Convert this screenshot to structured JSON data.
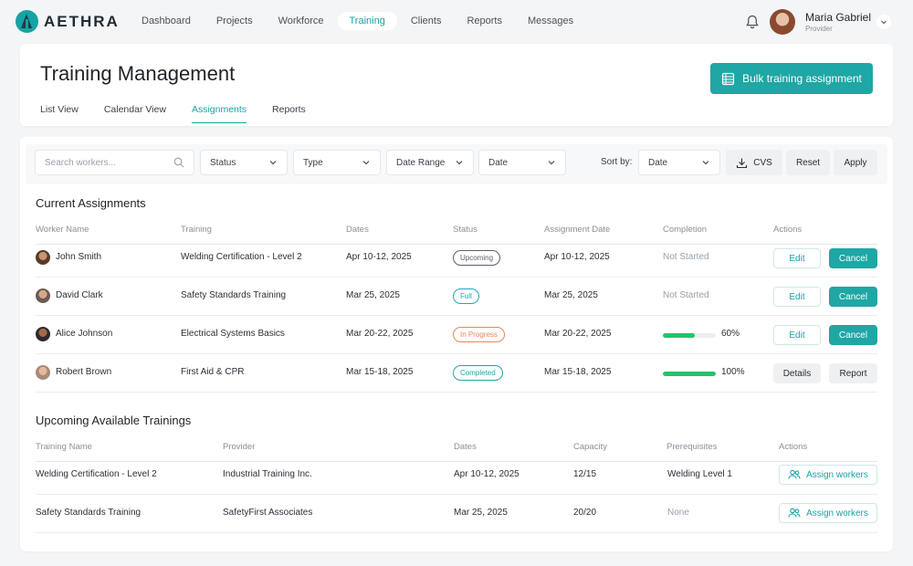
{
  "brand": {
    "name": "AETHRA"
  },
  "nav": {
    "items": [
      {
        "label": "Dashboard"
      },
      {
        "label": "Projects"
      },
      {
        "label": "Workforce"
      },
      {
        "label": "Training"
      },
      {
        "label": "Clients"
      },
      {
        "label": "Reports"
      },
      {
        "label": "Messages"
      }
    ],
    "active": "Training"
  },
  "user": {
    "name": "Maria Gabriel",
    "role": "Provider"
  },
  "page": {
    "title": "Training Management",
    "bulk_button": "Bulk training assignment",
    "tabs": [
      {
        "label": "List View"
      },
      {
        "label": "Calendar View"
      },
      {
        "label": "Assignments"
      },
      {
        "label": "Reports"
      }
    ],
    "active_tab": "Assignments"
  },
  "filters": {
    "search_placeholder": "Search workers...",
    "status": "Status",
    "type": "Type",
    "date_range": "Date Range",
    "date": "Date",
    "sort_label": "Sort by:",
    "sort_value": "Date",
    "export": "CVS",
    "reset": "Reset",
    "apply": "Apply"
  },
  "assignments": {
    "title": "Current Assignments",
    "columns": [
      "Worker Name",
      "Training",
      "Dates",
      "Status",
      "Assignment Date",
      "Completion",
      "Actions"
    ],
    "rows": [
      {
        "name": "John Smith",
        "training": "Welding Certification - Level 2",
        "dates": "Apr 10-12, 2025",
        "status": "Upcoming",
        "assigned": "Apr 10-12, 2025",
        "completion_text": "Not Started",
        "action1": "Edit",
        "action2": "Cancel"
      },
      {
        "name": "David Clark",
        "training": "Safety Standards Training",
        "dates": "Mar 25, 2025",
        "status": "Full",
        "assigned": "Mar 25, 2025",
        "completion_text": "Not Started",
        "action1": "Edit",
        "action2": "Cancel"
      },
      {
        "name": "Alice Johnson",
        "training": "Electrical Systems Basics",
        "dates": "Mar 20-22, 2025",
        "status": "In Progress",
        "assigned": "Mar 20-22, 2025",
        "completion_text": "60%",
        "completion": 0.6,
        "action1": "Edit",
        "action2": "Cancel"
      },
      {
        "name": "Robert Brown",
        "training": "First Aid & CPR",
        "dates": "Mar 15-18, 2025",
        "status": "Completed",
        "assigned": "Mar 15-18, 2025",
        "completion_text": "100%",
        "completion": 1.0,
        "action1": "Details",
        "action2": "Report"
      }
    ]
  },
  "upcoming": {
    "title": "Upcoming Available Trainings",
    "columns": [
      "Training Name",
      "Provider",
      "Dates",
      "Capacity",
      "Prerequisites",
      "Actions"
    ],
    "rows": [
      {
        "name": "Welding Certification - Level 2",
        "provider": "Industrial Training Inc.",
        "dates": "Apr 10-12, 2025",
        "capacity": "12/15",
        "prereq": "Welding Level 1",
        "action": "Assign workers"
      },
      {
        "name": "Safety Standards Training",
        "provider": "SafetyFirst Associates",
        "dates": "Mar 25, 2025",
        "capacity": "20/20",
        "prereq": "None",
        "action": "Assign workers"
      }
    ]
  },
  "colors": {
    "accent": "#1ea7a4",
    "progress": "#22c36e",
    "upcoming": "#5a6068",
    "full": "#1fa6c9",
    "in_progress": "#e8875a",
    "completed": "#1ea7a4"
  }
}
